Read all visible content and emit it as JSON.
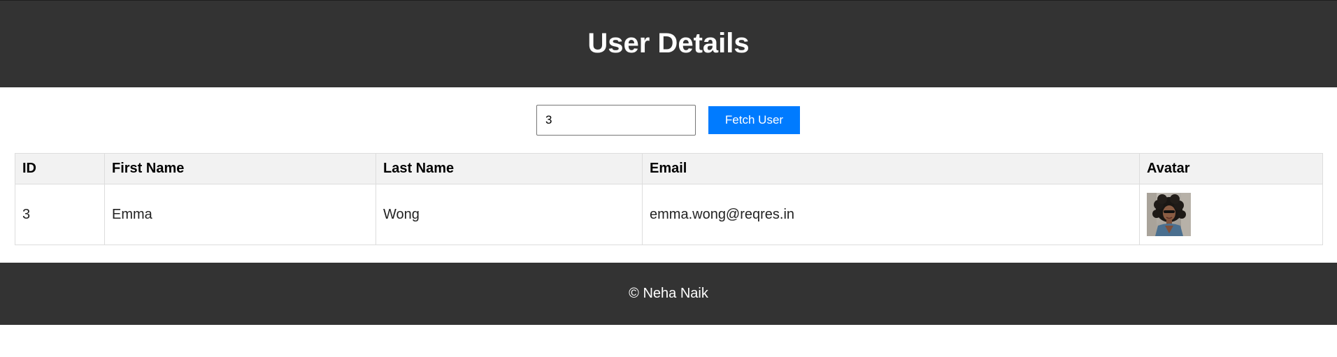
{
  "header": {
    "title": "User Details"
  },
  "controls": {
    "input_value": "3",
    "fetch_label": "Fetch User"
  },
  "table": {
    "headers": [
      "ID",
      "First Name",
      "Last Name",
      "Email",
      "Avatar"
    ],
    "rows": [
      {
        "id": "3",
        "first_name": "Emma",
        "last_name": "Wong",
        "email": "emma.wong@reqres.in",
        "avatar": "user-avatar-photo"
      }
    ]
  },
  "footer": {
    "text": "© Neha Naik"
  },
  "colors": {
    "header_bg": "#333333",
    "button_bg": "#007bff",
    "table_header_bg": "#f2f2f2",
    "border": "#dddddd"
  }
}
